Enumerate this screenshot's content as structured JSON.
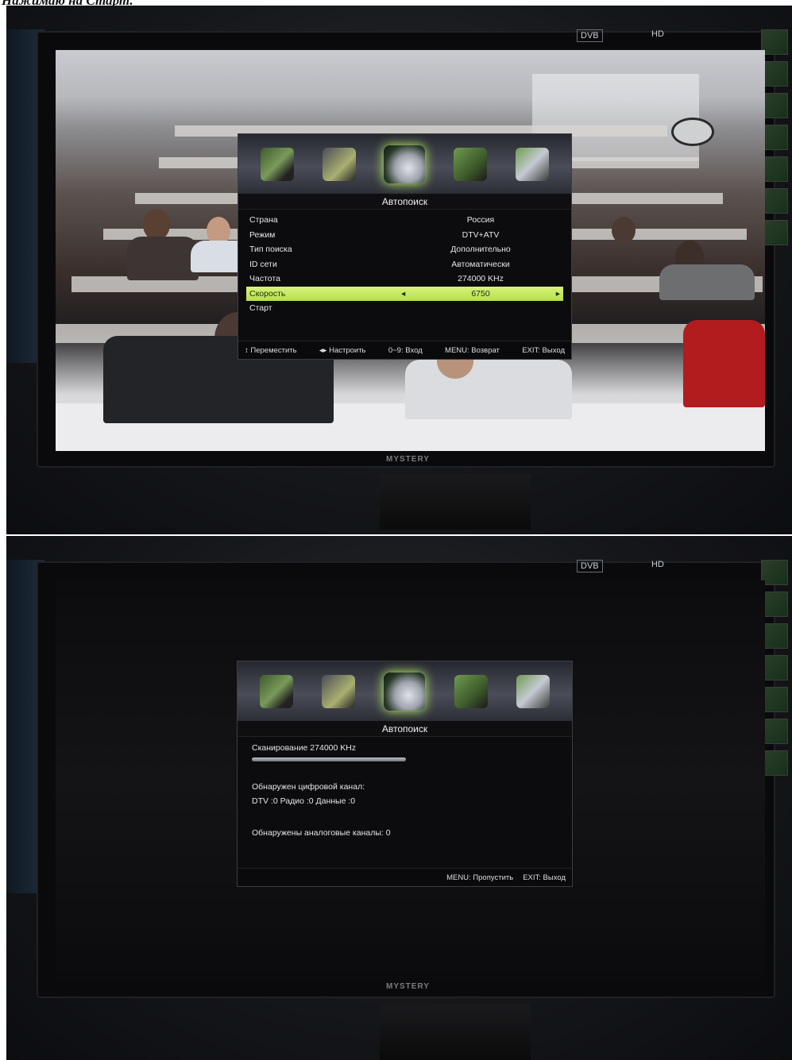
{
  "caption": "Нажимаю на Старт.",
  "tv": {
    "brand": "MYSTERY",
    "dvb_badge": "DVB",
    "hd_badge": "HD"
  },
  "osd1": {
    "tabs": [
      {
        "name": "picture",
        "icon": "picture-icon"
      },
      {
        "name": "sound",
        "icon": "sound-icon"
      },
      {
        "name": "channel",
        "icon": "satellite-dish-icon",
        "selected": true
      },
      {
        "name": "lock",
        "icon": "lock-icon"
      },
      {
        "name": "setup",
        "icon": "gear-icon"
      }
    ],
    "title": "Автопоиск",
    "rows": [
      {
        "label": "Страна",
        "value": "Россия"
      },
      {
        "label": "Режим",
        "value": "DTV+ATV"
      },
      {
        "label": "Тип поиска",
        "value": "Дополнительно"
      },
      {
        "label": "ID сети",
        "value": "Автоматически"
      },
      {
        "label": "Частота",
        "value": "274000 KHz"
      },
      {
        "label": "Скорость",
        "value": "6750",
        "highlighted": true
      },
      {
        "label": "Старт",
        "value": ""
      }
    ],
    "footer": {
      "move": "↕ Переместить",
      "adjust": "◂▸ Настроить",
      "enter": "0~9: Вход",
      "back": "MENU: Возврат",
      "exit": "EXIT: Выход"
    }
  },
  "osd2": {
    "title": "Автопоиск",
    "scanning": "Сканирование 274000 KHz",
    "progress": 0.0,
    "digital_found": "Обнаружен цифровой канал:",
    "digital_counts": "DTV :0  Радио :0  Данные :0",
    "analog_found": "Обнаружены аналоговые каналы: 0",
    "footer": {
      "skip": "MENU: Пропустить",
      "exit": "EXIT: Выход"
    }
  }
}
